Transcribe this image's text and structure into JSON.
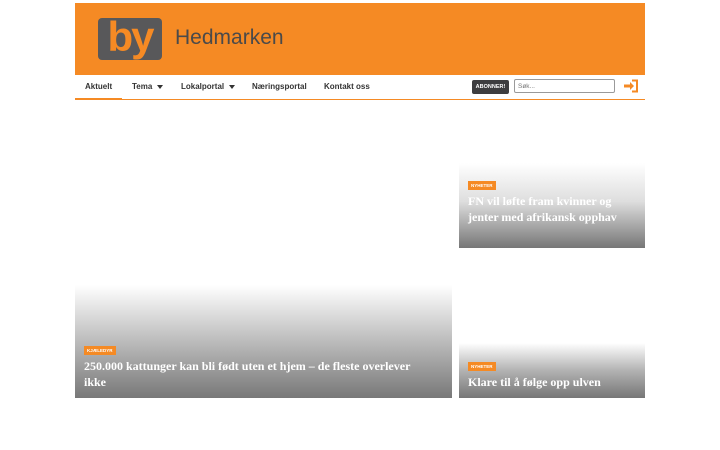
{
  "brand": {
    "logo_text": "by",
    "name": "Hedmarken",
    "accent": "#f58a24"
  },
  "nav": {
    "items": [
      {
        "label": "Aktuelt",
        "active": true
      },
      {
        "label": "Tema"
      },
      {
        "label": "Lokalportal"
      },
      {
        "label": "Næringsportal"
      },
      {
        "label": "Kontakt oss"
      }
    ],
    "subscribe_label": "ABONNER!",
    "search_placeholder": "Søk...",
    "login_icon": "sign-in-icon"
  },
  "articles": [
    {
      "tag": "NYHETER",
      "title": "FN vil løfte fram kvinner og jenter med afrikansk opphav"
    },
    {
      "tag": "KJÆLEDYR",
      "title": "250.000 kattunger kan bli født uten et hjem – de fleste overlever ikke"
    },
    {
      "tag": "NYHETER",
      "title": "Klare til å følge opp ulven"
    }
  ]
}
